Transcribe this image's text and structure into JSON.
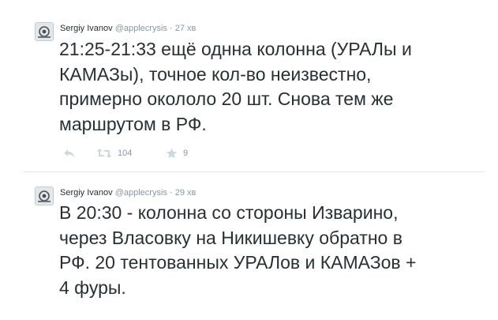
{
  "tweets": [
    {
      "author": {
        "fullname": "Sergiy Ivanov",
        "handle": "@applecrysis"
      },
      "separator": "·",
      "time": "27 хв",
      "text": "21:25-21:33 ещё однна колонна (УРАЛы и\nКАМАЗы), точное кол-во неизвестно,\nпримерно окололо 20 шт. Снова тем же\nмаршрутом в РФ.",
      "actions": {
        "reply_icon": "reply-icon",
        "retweet_icon": "retweet-icon",
        "retweet_count": "104",
        "favorite_icon": "star-icon",
        "favorite_count": "9"
      }
    },
    {
      "author": {
        "fullname": "Sergiy Ivanov",
        "handle": "@applecrysis"
      },
      "separator": "·",
      "time": "29 хв",
      "text": "В 20:30 - колонна со стороны Изварино,\nчерез Власовку на Никишевку обратно в\nРФ.  20 тентованных УРАЛов и КАМАЗов +\n4 фуры."
    }
  ],
  "colors": {
    "text": "#292f33",
    "muted": "#8899a6",
    "divider": "#e1e8ed",
    "icon": "#ccd6dd"
  }
}
